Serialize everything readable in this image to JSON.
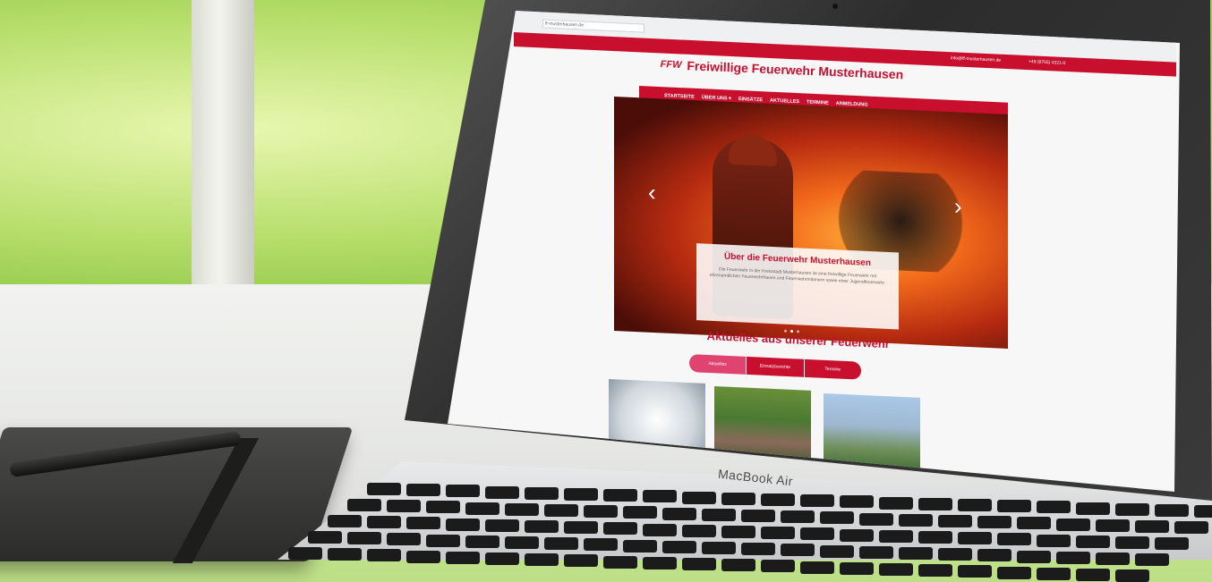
{
  "browser": {
    "address": "ff-musterhausen.de"
  },
  "topbar": {
    "email": "info@ff-musterhausen.de",
    "phone": "+49 (8765) 4321-0"
  },
  "site": {
    "logo": "FFW",
    "title": "Freiwillige Feuerwehr Musterhausen"
  },
  "nav": {
    "items": [
      "STARTSEITE",
      "ÜBER UNS ▾",
      "EINSÄTZE",
      "AKTUELLES",
      "TERMINE",
      "ANMELDUNG"
    ]
  },
  "hero": {
    "prev": "‹",
    "next": "›",
    "caption_title": "Über die Feuerwehr Musterhausen",
    "caption_text": "Die Feuerwehr in der Kreisstadt Musterhausen ist eine freiwillige Feuerwehr mit ehrenamtlichen Feuerwehrfrauen und Feuerwehrmännern sowie einer Jugendfeuerwehr."
  },
  "news": {
    "title": "Aktuelles aus unserer Feuerwehr",
    "tabs": [
      "Aktuelles",
      "Einsatzberichte",
      "Termine"
    ]
  },
  "laptop": {
    "brand": "MacBook Air"
  }
}
